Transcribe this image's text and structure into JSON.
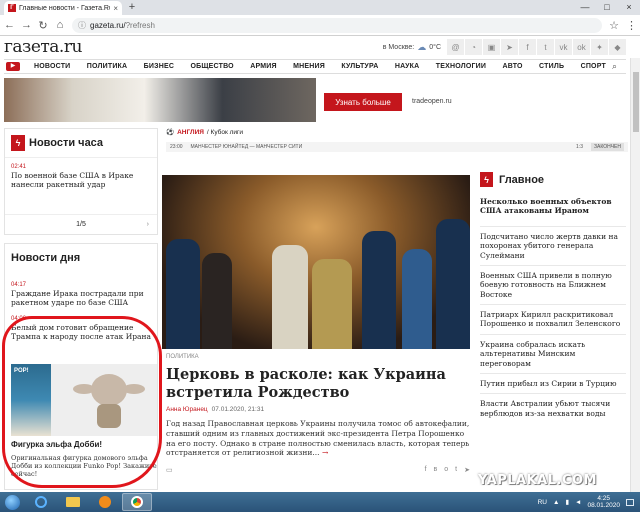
{
  "browser": {
    "tab_title": "Главные новости - Газета.Ru",
    "url_host": "gazeta.ru/",
    "url_path": "?refresh"
  },
  "site": {
    "logo": "газета.ru",
    "city_label": "в Москве:",
    "temperature": "0°C"
  },
  "menu": {
    "items": [
      "НОВОСТИ",
      "ПОЛИТИКА",
      "БИЗНЕС",
      "ОБЩЕСТВО",
      "АРМИЯ",
      "МНЕНИЯ",
      "КУЛЬТУРА",
      "НАУКА",
      "ТЕХНОЛОГИИ",
      "АВТО",
      "СТИЛЬ",
      "СПОРТ"
    ]
  },
  "banner": {
    "button": "Узнать больше",
    "url": "tradeopen.ru"
  },
  "news_hour": {
    "title": "Новости часа",
    "time": "02:41",
    "text": "По военной базе США в Ираке нанесли ракетный удар",
    "pager": "1/5"
  },
  "news_day": {
    "title": "Новости дня",
    "items": [
      {
        "time": "04:17",
        "text": "Граждане Ирака пострадали при ракетном ударе по базе США"
      },
      {
        "time": "04:06",
        "text": "Белый дом готовит обращение Трампа к народу после атак Ирана"
      }
    ],
    "promo_title": "Фигурка эльфа Добби!",
    "promo_desc": "Оригинальная фигурка домового эльфа Добби из коллекции Funko Pop! Закажите сейчас!"
  },
  "match": {
    "country": "АНГЛИЯ",
    "tournament": "/ Кубок лиги",
    "time": "23:00",
    "teams": "МАНЧЕСТЕР ЮНАЙТЕД — МАНЧЕСТЕР СИТИ",
    "score": "1:3",
    "status": "ЗАКОНЧЕН"
  },
  "article": {
    "category": "ПОЛИТИКА",
    "title": "Церковь в расколе: как Украина встретила Рождество",
    "author": "Анна Юранец",
    "date": "07.01.2020, 21:31",
    "lead": "Год назад Православная церковь Украины получила томос об автокефалии, ставший одним из главных достижений экс-президента Петра Порошенко на его посту. Однако в стране полностью сменилась власть, которая теперь отстраняется от религиозной жизни...",
    "more": "→"
  },
  "main_news": {
    "title": "Главное",
    "lead": "Несколько военных объектов США атакованы Ираном",
    "items": [
      "Подсчитано число жертв давки на похоронах убитого генерала Сулеймани",
      "Военных США привели в полную боевую готовность на Ближнем Востоке",
      "Патриарх Кирилл раскритиковал Порошенко и похвалил Зеленского",
      "Украина собралась искать альтернативы Минским переговорам",
      "Путин прибыл из Сирии в Турцию",
      "Власти Австралии убьют тысячи верблюдов из-за нехватки воды"
    ]
  },
  "watermark": "YAPLAKAL.COM",
  "taskbar": {
    "lang": "RU",
    "time": "4:25",
    "date": "08.01.2020"
  },
  "colors": {
    "accent": "#c4161c",
    "circle": "#e0161c"
  }
}
